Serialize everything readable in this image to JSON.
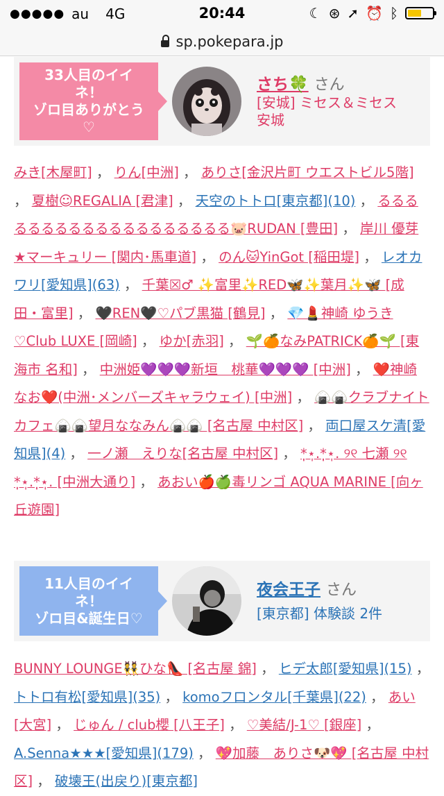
{
  "status_bar": {
    "signal": "●●●●●",
    "carrier": "au",
    "network": "4G",
    "time": "20:44",
    "battery_level": 0.55
  },
  "browser": {
    "url": "sp.pokepara.jp"
  },
  "colors": {
    "pink": "#de3b66",
    "blue": "#2b73b6",
    "ribbon_pink": "#f48aa6",
    "ribbon_blue": "#8fb4ee",
    "card_bg": "#f4f4f4"
  },
  "cards": [
    {
      "ribbon": [
        "33人目のイイ",
        "ネ！",
        "ゾロ目ありがとう",
        "♡"
      ],
      "name": "さち🍀",
      "san": "さん",
      "sub": [
        "[安城] ミセス＆ミセス",
        "安城"
      ]
    },
    {
      "ribbon": [
        "11人目のイイ",
        "ネ！",
        "ゾロ目&誕生日♡"
      ],
      "name": "夜会王子",
      "san": "さん",
      "sub": [
        "[東京都] 体験談 2件"
      ]
    }
  ],
  "likes_1": [
    {
      "t": "みき[木屋町]",
      "c": "pink"
    },
    {
      "t": "りん[中洲]",
      "c": "pink"
    },
    {
      "t": "ありさ[金沢片町 ウエストビル5階]",
      "c": "pink"
    },
    {
      "t": "夏樹☺REGALIA [君津]",
      "c": "pink"
    },
    {
      "t": "天空のトトロ[東京都](10)",
      "c": "blue"
    },
    {
      "t": "るるるるるるるるるるるるるるるるるるる🐷RUDAN [豊田]",
      "c": "pink"
    },
    {
      "t": "岸川 優芽★マーキュリー [関内･馬車道]",
      "c": "pink"
    },
    {
      "t": "のん🐱YinGot [稲田堤]",
      "c": "pink"
    },
    {
      "t": "レオカワリ[愛知県](63)",
      "c": "blue"
    },
    {
      "t": "千葉☒♂ ✨富里✨RED🦋✨葉月✨🦋 [成田・富里]",
      "c": "pink"
    },
    {
      "t": "🖤REN🖤♡パブ黒猫 [鶴見]",
      "c": "pink"
    },
    {
      "t": "💎💄神崎 ゆうき♡Club LUXE [岡崎]",
      "c": "pink"
    },
    {
      "t": "ゆか[赤羽]",
      "c": "pink"
    },
    {
      "t": "🌱🍊なみPATRICK🍊🌱 [東海市 名和]",
      "c": "pink"
    },
    {
      "t": "中洲姫💜💜💜新垣　桃華💜💜💜 [中洲]",
      "c": "pink"
    },
    {
      "t": "❤️神崎なお❤️(中洲･メンバーズキャラウェイ) [中洲]",
      "c": "pink"
    },
    {
      "t": "🍙🍙クラブナイトカフェ🍙🍙望月ななみん🍙🍙 [名古屋 中村区]",
      "c": "pink"
    },
    {
      "t": "両口屋スケ清[愛知県](4)",
      "c": "blue"
    },
    {
      "t": "一ノ瀬　えりな[名古屋 中村区]",
      "c": "pink"
    },
    {
      "t": "*̣̩⋆̩.*̣̩⋆̩. ୨୧ 七瀬 ୨୧ *̣̩⋆̩.*̣̩⋆̩. [中洲大通り]",
      "c": "pink"
    },
    {
      "t": "あおい🍎🍏毒リンゴ AQUA MARINE [向ヶ丘遊園]",
      "c": "pink"
    }
  ],
  "likes_2": [
    {
      "t": "BUNNY LOUNGE👯ひな👠 [名古屋 錦]",
      "c": "pink"
    },
    {
      "t": "ヒデ太郎[愛知県](15)",
      "c": "blue"
    },
    {
      "t": "トトロ有松[愛知県](35)",
      "c": "blue"
    },
    {
      "t": "komoフロンタル[千葉県](22)",
      "c": "blue"
    },
    {
      "t": "あい[大宮]",
      "c": "pink"
    },
    {
      "t": "じゅん / club櫻 [八王子]",
      "c": "pink"
    },
    {
      "t": "♡美結/J-1♡ [銀座]",
      "c": "pink"
    },
    {
      "t": "A.Senna★★★[愛知県](179)",
      "c": "blue"
    },
    {
      "t": "💖加藤　ありさ🐶💖 [名古屋 中村区]",
      "c": "pink"
    },
    {
      "t": "破壊王(出戻り)[東京都]",
      "c": "blue"
    }
  ]
}
